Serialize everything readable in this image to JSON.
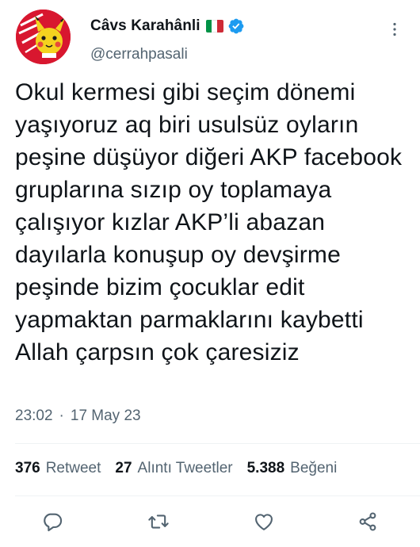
{
  "user": {
    "display_name": "Câvs Karahânli",
    "handle": "@cerrahpasali",
    "flag": "🇮🇹",
    "verified": true
  },
  "tweet": {
    "text": "Okul kermesi gibi seçim dönemi yaşıyoruz aq biri usulsüz oyların peşine düşüyor diğeri AKP facebook gruplarına sızıp oy toplamaya çalışıyor kızlar AKP’li abazan dayılarla konuşup oy devşirme peşinde bizim çocuklar edit yapmaktan parmaklarını kaybetti Allah çarpsın çok çaresiziz",
    "time": "23:02",
    "separator": "·",
    "date": "17 May 23"
  },
  "stats": {
    "retweets_count": "376",
    "retweets_label": "Retweet",
    "quotes_count": "27",
    "quotes_label": "Alıntı Tweetler",
    "likes_count": "5.388",
    "likes_label": "Beğeni"
  },
  "icons": {
    "reply": "reply-icon",
    "retweet": "retweet-icon",
    "like": "like-icon",
    "share": "share-icon",
    "more": "more-icon",
    "verified": "verified-badge-icon"
  },
  "colors": {
    "text_primary": "#0f1419",
    "text_secondary": "#536471",
    "verified_blue": "#1d9bf0",
    "avatar_bg": "#d8172f",
    "flag_green": "#009246",
    "flag_white": "#ffffff",
    "flag_red": "#ce2b37"
  }
}
